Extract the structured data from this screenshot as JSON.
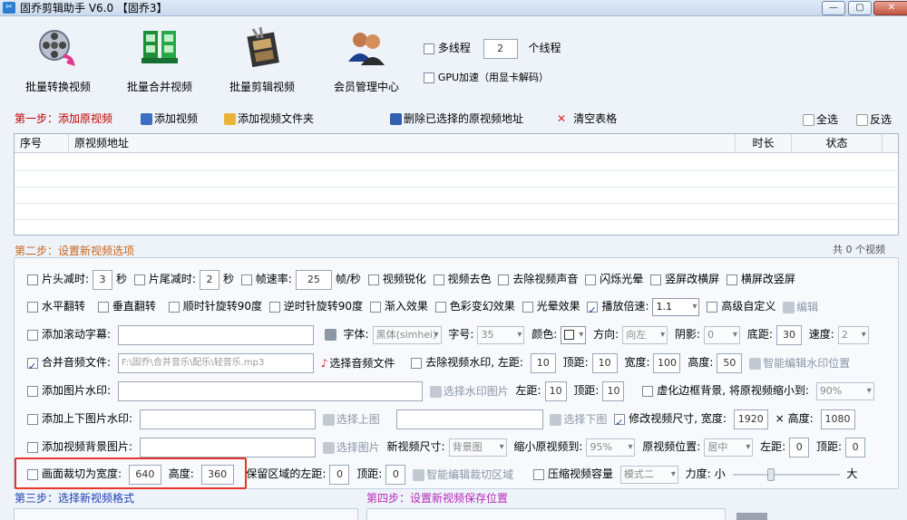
{
  "window": {
    "title": "固乔剪辑助手 V6.0  【固乔3】",
    "app_icon": "✂"
  },
  "toolbar": {
    "batch_convert": "批量转换视频",
    "batch_merge": "批量合并视频",
    "batch_edit": "批量剪辑视频",
    "member_center": "会员管理中心",
    "multithread_label": "多线程",
    "thread_count": "2",
    "thread_unit": "个线程",
    "gpu_label": "GPU加速（用显卡解码）"
  },
  "step1": {
    "title": "第一步：添加原视频",
    "add_video": "添加视频",
    "add_folder": "添加视频文件夹",
    "delete_selected": "删除已选择的原视频地址",
    "clear_table": "清空表格",
    "select_all": "全选",
    "invert": "反选"
  },
  "table": {
    "columns": [
      "序号",
      "原视频地址",
      "时长",
      "状态"
    ]
  },
  "step2": {
    "title": "第二步：设置新视频选项",
    "count": "共 0 个视频"
  },
  "opts": {
    "head_cut": "片头减时:",
    "head_val": "3",
    "sec": "秒",
    "tail_cut": "片尾减时:",
    "tail_val": "2",
    "fps": "帧速率:",
    "fps_val": "25",
    "fps_unit": "帧/秒",
    "sharpen": "视频锐化",
    "decolor": "视频去色",
    "remove_audio": "去除视频声音",
    "flash": "闪烁光晕",
    "v2h": "竖屏改横屏",
    "h2v": "横屏改竖屏",
    "hflip": "水平翻转",
    "vflip": "垂直翻转",
    "rot_cw": "顺时针旋转90度",
    "rot_ccw": "逆时针旋转90度",
    "fade": "渐入效果",
    "color_fx": "色彩变幻效果",
    "glow": "光晕效果",
    "speed_label": "播放倍速:",
    "speed_val": "1.1",
    "advanced": "高级自定义",
    "edit": "编辑",
    "subtitle": "添加滚动字幕:",
    "font_label": "字体:",
    "font_val": "黑体(simhei)",
    "size_label": "字号:",
    "size_val": "35",
    "color_label": "颜色:",
    "dir_label": "方向:",
    "dir_val": "向左",
    "shadow_label": "阴影:",
    "shadow_val": "0",
    "bottom_label": "底距:",
    "bottom_val": "30",
    "speed2_label": "速度:",
    "speed2_val": "2",
    "merge_audio": "合并音频文件:",
    "audio_path": "F:\\固乔\\合并音乐\\配乐\\轻音乐.mp3",
    "choose_audio": "选择音频文件",
    "remove_wm": "去除视频水印, 左距:",
    "wm_left": "10",
    "top_label": "顶距:",
    "wm_top": "10",
    "width_label": "宽度:",
    "wm_w": "100",
    "height_label": "高度:",
    "wm_h": "50",
    "smart_wm": "智能编辑水印位置",
    "img_wm": "添加图片水印:",
    "choose_wm_img": "选择水印图片",
    "left_label": "左距:",
    "img_left": "10",
    "img_top": "10",
    "blur_bg": "虚化边框背景, 将原视频缩小到:",
    "blur_val": "90%",
    "updown_img": "添加上下图片水印:",
    "choose_up": "选择上图",
    "choose_down": "选择下图",
    "resize": "修改视频尺寸, 宽度:",
    "res_w": "1920",
    "times": "×",
    "height2_label": "高度:",
    "res_h": "1080",
    "bg_img": "添加视频背景图片:",
    "choose_img": "选择图片",
    "new_size": "新视频尺寸:",
    "new_size_val": "背景图",
    "shrink": "缩小原视频到:",
    "shrink_val": "95%",
    "pos_label": "原视频位置:",
    "pos_val": "居中",
    "bg_left": "0",
    "bg_top": "0",
    "crop": "画面裁切为宽度:",
    "crop_w": "640",
    "crop_h": "360",
    "keep_left": "保留区域的左距:",
    "keep_left_val": "0",
    "keep_top": "0",
    "smart_crop": "智能编辑裁切区域",
    "compress": "压缩视频容量",
    "compress_mode": "模式二",
    "strength": "力度:",
    "small": "小",
    "big": "大",
    "strength_pct": 35
  },
  "step3": {
    "title": "第三步：选择新视频格式"
  },
  "step4": {
    "title": "第四步：设置新视频保存位置"
  },
  "colors": {
    "highlight": "#e8342a",
    "step_red": "#c00000",
    "step_orange": "#c8641b"
  }
}
